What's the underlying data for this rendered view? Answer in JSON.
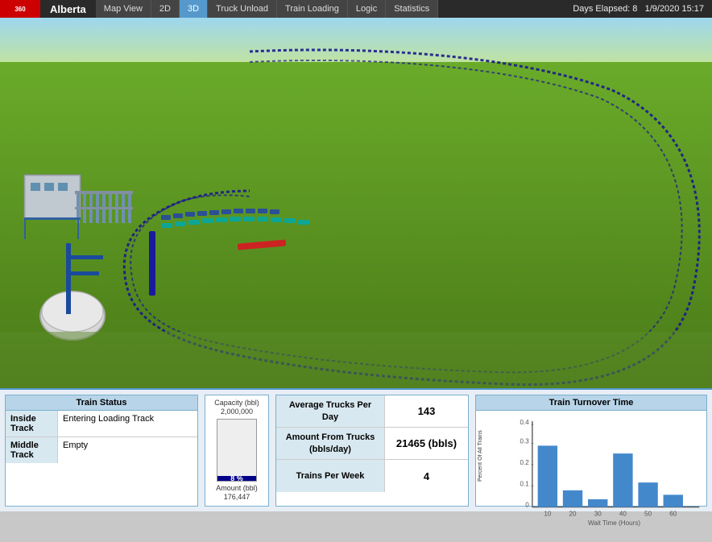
{
  "app": {
    "logo": "360",
    "location": "Alberta",
    "days_elapsed_label": "Days Elapsed: 8",
    "datetime": "1/9/2020  15:17"
  },
  "nav": {
    "tabs": [
      {
        "label": "Map View",
        "active": false
      },
      {
        "label": "2D",
        "active": false
      },
      {
        "label": "3D",
        "active": true
      },
      {
        "label": "Truck Unload",
        "active": false
      },
      {
        "label": "Train Loading",
        "active": false
      },
      {
        "label": "Logic",
        "active": false
      },
      {
        "label": "Statistics",
        "active": false
      }
    ]
  },
  "train_status": {
    "title": "Train Status",
    "rows": [
      {
        "label": "Inside Track",
        "value": "Entering Loading Track"
      },
      {
        "label": "Middle Track",
        "value": "Empty"
      }
    ]
  },
  "capacity": {
    "title_line1": "Capacity (bbl)",
    "title_line2": "2,000,000",
    "percent": "8 %",
    "percent_number": 8,
    "amount_label": "Amount (bbl)",
    "amount_value": "176,447"
  },
  "stats": {
    "rows": [
      {
        "label": "Average Trucks Per Day",
        "value": "143"
      },
      {
        "label": "Amount From Trucks (bbls/day)",
        "value": "21465 (bbls)"
      },
      {
        "label": "Trains Per Week",
        "value": "4"
      }
    ]
  },
  "turnover_chart": {
    "title": "Train Turnover Time",
    "y_axis_label": "Percent Of All Trains",
    "x_axis_label": "Wait Time (Hours)",
    "bars": [
      {
        "x_label": "10",
        "height_pct": 75
      },
      {
        "x_label": "20",
        "height_pct": 20
      },
      {
        "x_label": "30",
        "height_pct": 10
      },
      {
        "x_label": "40",
        "height_pct": 65
      },
      {
        "x_label": "50",
        "height_pct": 30
      },
      {
        "x_label": "60",
        "height_pct": 15
      }
    ],
    "y_ticks": [
      "0.1",
      "0.2",
      "0.3",
      "0.4"
    ]
  }
}
